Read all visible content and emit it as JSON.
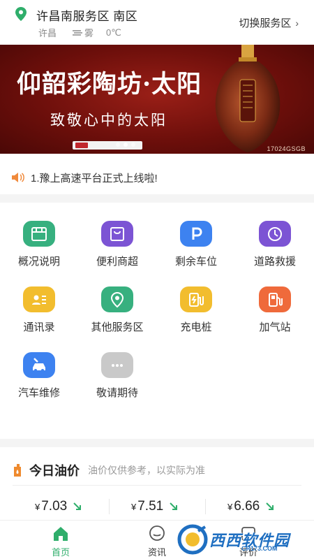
{
  "header": {
    "station_name": "许昌南服务区 南区",
    "city": "许昌",
    "weather": "雾",
    "temperature": "0℃",
    "switch_label": "切换服务区",
    "accent_color": "#2fae6b"
  },
  "banner": {
    "headline": "仰韶彩陶坊·太阳",
    "slogan": "致敬心中的太阳",
    "code": "17024GSGB",
    "slide_count": 3,
    "active_slide": 2
  },
  "notice": {
    "text": "1.豫上高速平台正式上线啦!"
  },
  "services": [
    {
      "label": "概况说明",
      "icon": "store-icon",
      "color": "#37b07f"
    },
    {
      "label": "便利商超",
      "icon": "shopping-bag-icon",
      "color": "#7c54d4"
    },
    {
      "label": "剩余车位",
      "icon": "parking-icon",
      "color": "#3d82f0"
    },
    {
      "label": "道路救援",
      "icon": "rescue-clock-icon",
      "color": "#7c54d4"
    },
    {
      "label": "通讯录",
      "icon": "contacts-icon",
      "color": "#f2bd2e"
    },
    {
      "label": "其他服务区",
      "icon": "location-pin-icon",
      "color": "#37b07f"
    },
    {
      "label": "充电桩",
      "icon": "charging-icon",
      "color": "#f2bd2e"
    },
    {
      "label": "加气站",
      "icon": "gas-station-icon",
      "color": "#ef6a3b"
    },
    {
      "label": "汽车维修",
      "icon": "car-repair-icon",
      "color": "#3d82f0"
    },
    {
      "label": "敬请期待",
      "icon": "more-icon",
      "color": "#c9c9c9"
    }
  ],
  "oil": {
    "title": "今日油价",
    "note": "油价仅供参考，以实际为准",
    "currency": "¥",
    "prices": [
      {
        "value": "7.03",
        "trend": "down"
      },
      {
        "value": "7.51",
        "trend": "down"
      },
      {
        "value": "6.66",
        "trend": "down"
      }
    ]
  },
  "nav": {
    "items": [
      {
        "label": "首页",
        "icon": "home-icon",
        "active": true
      },
      {
        "label": "资讯",
        "icon": "chat-icon",
        "active": false
      },
      {
        "label": "评价",
        "icon": "review-icon",
        "active": false
      }
    ]
  },
  "watermark": {
    "text": "西西软件园",
    "sub": "CR173.COM"
  }
}
